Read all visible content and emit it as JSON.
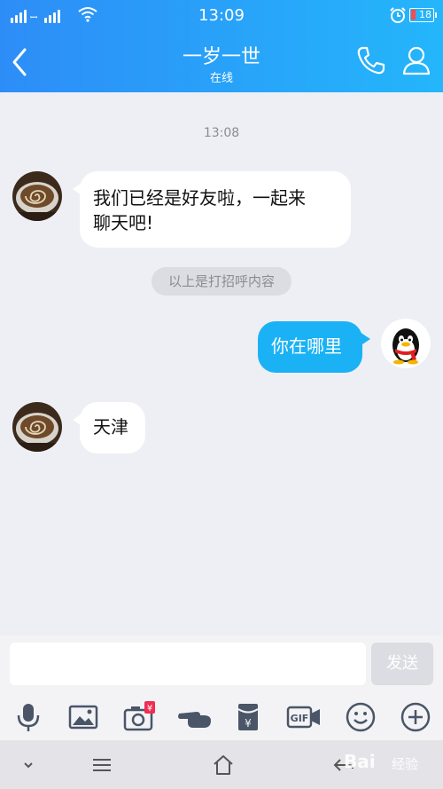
{
  "status_bar": {
    "time": "13:09",
    "battery": "18"
  },
  "header": {
    "title": "一岁一世",
    "subtitle": "在线"
  },
  "chat": {
    "time_label": "13:08",
    "system_notice": "以上是打招呼内容",
    "messages": [
      {
        "side": "left",
        "text": "我们已经是好友啦，一起来\n聊天吧!"
      },
      {
        "side": "right",
        "text": "你在哪里"
      },
      {
        "side": "left",
        "text": "天津"
      }
    ]
  },
  "input": {
    "value": "",
    "send_label": "发送"
  },
  "toolbar": {
    "gif_label": "GIF",
    "money_label": "¥"
  },
  "watermark": {
    "brand": "Bai",
    "brand_cn": "经验"
  },
  "icons": [
    "back-icon",
    "phone-icon",
    "profile-icon",
    "mic-icon",
    "image-icon",
    "camera-icon",
    "poke-icon",
    "red-packet-icon",
    "gif-icon",
    "emoji-icon",
    "plus-icon"
  ],
  "colors": {
    "header_start": "#2d8df7",
    "header_end": "#24b6fb",
    "my_bubble": "#1bb2f5",
    "background": "#eeeff4"
  }
}
